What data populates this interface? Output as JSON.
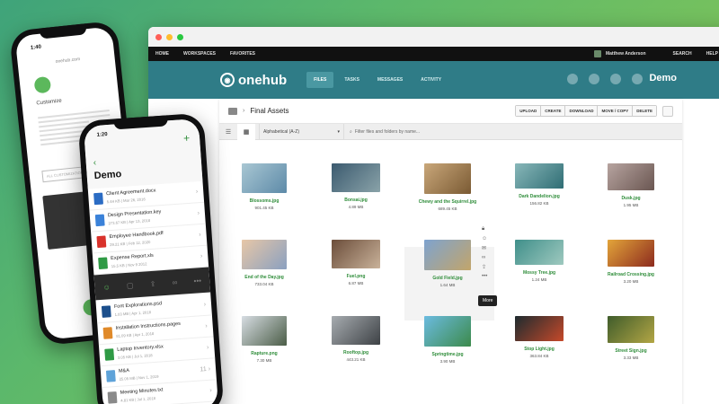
{
  "browser": {
    "topnav": {
      "home": "HOME",
      "workspaces": "WORKSPACES",
      "favorites": "FAVORITES",
      "user": "Matthew Anderson",
      "search": "SEARCH",
      "help": "HELP"
    },
    "logo": "onehub",
    "tabs": [
      {
        "label": "FILES",
        "active": true
      },
      {
        "label": "TASKS",
        "active": false
      },
      {
        "label": "MESSAGES",
        "active": false
      },
      {
        "label": "ACTIVITY",
        "active": false
      }
    ],
    "workspace_name": "Demo",
    "folder": {
      "title": "Final Assets",
      "actions": [
        "UPLOAD",
        "CREATE",
        "DOWNLOAD",
        "MOVE / COPY",
        "DELETE"
      ],
      "sort": "Alphabetical (A-Z)",
      "search_placeholder": "Filter files and folders by name..."
    },
    "files": [
      {
        "name": "Blossoms.jpg",
        "size": "901.45 KB",
        "c1": "#a9c7d3",
        "c2": "#5d8aa8"
      },
      {
        "name": "Bonsai.jpg",
        "size": "4.89 MB",
        "c1": "#3b5a6f",
        "c2": "#8aa3a9"
      },
      {
        "name": "Chewy and the Squirrel.jpg",
        "size": "689.45 KB",
        "c1": "#c9a77a",
        "c2": "#7a5a33"
      },
      {
        "name": "Dark Dandelion.jpg",
        "size": "156.82 KB",
        "c1": "#88b7b9",
        "c2": "#2f6d74"
      },
      {
        "name": "Dusk.jpg",
        "size": "1.95 MB",
        "c1": "#b7a4a0",
        "c2": "#6a5651"
      },
      {
        "name": "End of the Day.jpg",
        "size": "733.04 KB",
        "c1": "#e7c7a7",
        "c2": "#8aa0c0"
      },
      {
        "name": "Fuel.png",
        "size": "6.87 MB",
        "c1": "#6b4d3a",
        "c2": "#c9b29a"
      },
      {
        "name": "Gold Field.jpg",
        "size": "1.64 MB",
        "c1": "#7ea3cf",
        "c2": "#c2a56a"
      },
      {
        "name": "Mossy Tree.jpg",
        "size": "1.24 MB",
        "c1": "#3f8f8a",
        "c2": "#9fc9bf"
      },
      {
        "name": "Railroad Crossing.jpg",
        "size": "3.20 MB",
        "c1": "#e3a53a",
        "c2": "#8c2a1e"
      },
      {
        "name": "Rapture.png",
        "size": "7.30 MB",
        "c1": "#d7dde3",
        "c2": "#4b5d47"
      },
      {
        "name": "Rooftop.jpg",
        "size": "443.21 KB",
        "c1": "#a7acb0",
        "c2": "#3d4145"
      },
      {
        "name": "Springtime.jpg",
        "size": "3.90 MB",
        "c1": "#6bbbe0",
        "c2": "#3c8a4b"
      },
      {
        "name": "Stop Light.jpg",
        "size": "363.84 KB",
        "c1": "#1d2b2f",
        "c2": "#c6492a"
      },
      {
        "name": "Street Sign.jpg",
        "size": "3.33 MB",
        "c1": "#3f5c2b",
        "c2": "#b3a645"
      }
    ],
    "tooltip": "More"
  },
  "phone_left": {
    "time": "1:40",
    "url": "onehub.com",
    "heading": "Customize",
    "button": "ALL CUSTOMIZATION"
  },
  "phone_right": {
    "time": "1:20",
    "title": "Demo",
    "files_top": [
      {
        "name": "Client Agreement.docx",
        "meta": "5.44 KB | Mar 26, 2016",
        "color": "#2b6cc4"
      },
      {
        "name": "Design Presentation.key",
        "meta": "273.67 KB | Apr 13, 2018",
        "color": "#3b82d9"
      },
      {
        "name": "Employee Handbook.pdf",
        "meta": "29.21 KB | Feb 12, 2020",
        "color": "#d9322b"
      },
      {
        "name": "Expense Report.xls",
        "meta": "15.5 KB | Nov 9 2012",
        "color": "#2f9a45"
      }
    ],
    "files_bottom": [
      {
        "name": "Font Explorations.psd",
        "meta": "1.03 MB | Apr 1, 2018",
        "color": "#1c4f8c"
      },
      {
        "name": "Installation Instructions.pages",
        "meta": "81.09 KB | Apr 1, 2018",
        "color": "#e08a2a"
      },
      {
        "name": "Laptop Inventory.xlsx",
        "meta": "3.05 KB | Jul 1, 2018",
        "color": "#2f9a45"
      },
      {
        "name": "M&A",
        "meta": "25.05 MB | Nov 1, 2019",
        "color": "#5fa3d9",
        "count": "11"
      },
      {
        "name": "Meeting Minutes.txt",
        "meta": "4.81 KB | Jul 1, 2018",
        "color": "#8a8a8a"
      }
    ],
    "actions": [
      "people-icon",
      "comment-icon",
      "share-icon",
      "link-icon",
      "more-icon"
    ]
  }
}
